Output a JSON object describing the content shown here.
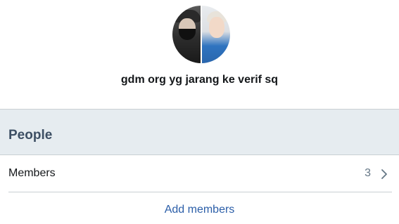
{
  "group": {
    "name": "gdm org yg jarang ke verif sq",
    "avatar_icon": "group-avatar"
  },
  "people_section": {
    "title": "People",
    "members_label": "Members",
    "members_count": "3",
    "chevron_icon": "chevron-right-icon"
  },
  "actions": {
    "add_members_label": "Add members"
  },
  "colors": {
    "accent": "#2b5ea8",
    "section_bg": "#e6ecf0",
    "section_title": "#3d4f64",
    "divider": "#c9cfd3"
  }
}
